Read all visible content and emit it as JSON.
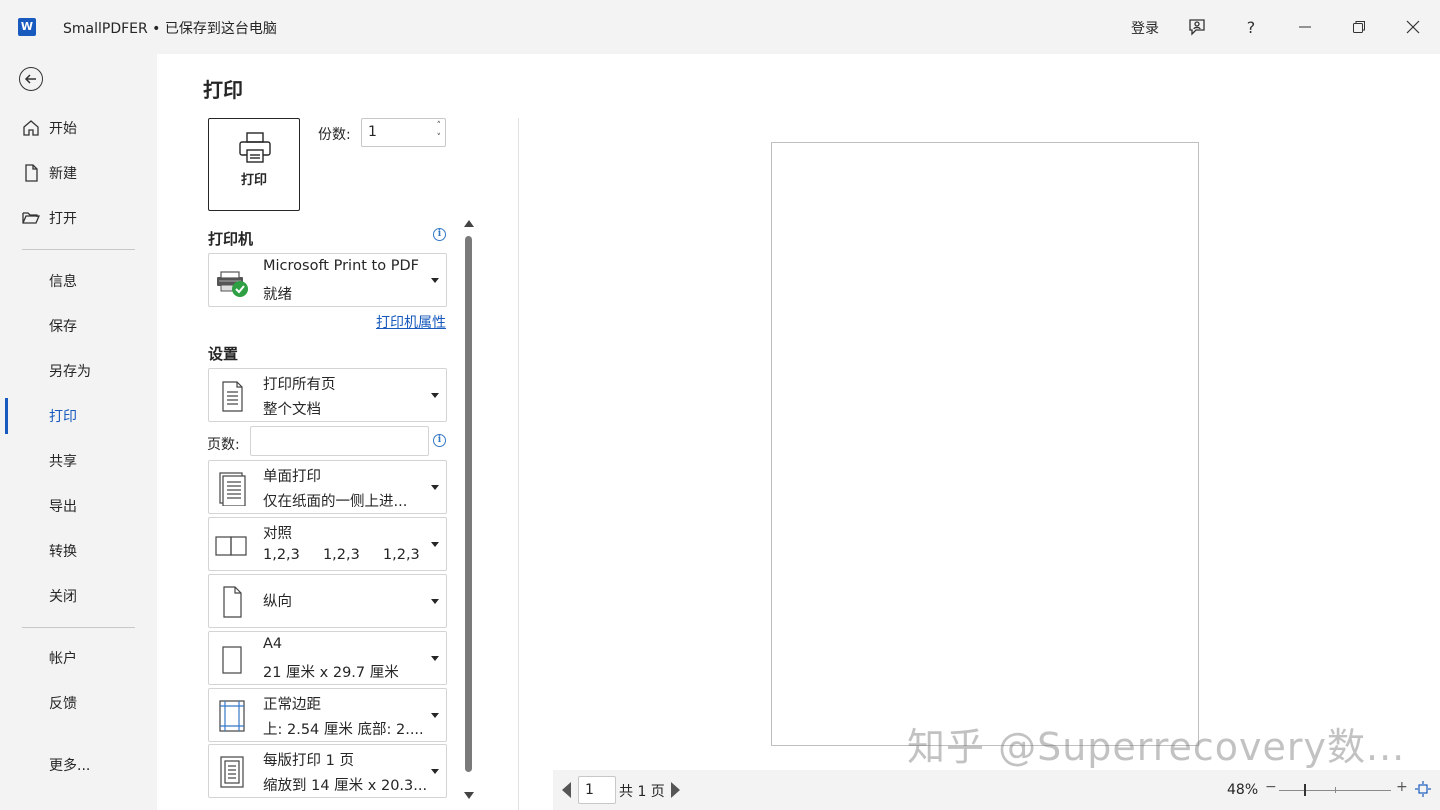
{
  "window": {
    "title": "SmallPDFER • 已保存到这台电脑",
    "app_letter": "W",
    "login": "登录",
    "help": "?"
  },
  "nav": {
    "top_items": [
      {
        "label": "开始"
      },
      {
        "label": "新建"
      },
      {
        "label": "打开"
      }
    ],
    "mid_items": [
      {
        "label": "信息"
      },
      {
        "label": "保存"
      },
      {
        "label": "另存为"
      },
      {
        "label": "打印",
        "active": true
      },
      {
        "label": "共享"
      },
      {
        "label": "导出"
      },
      {
        "label": "转换"
      },
      {
        "label": "关闭"
      }
    ],
    "bottom_items": [
      {
        "label": "帐户"
      },
      {
        "label": "反馈"
      },
      {
        "label": "更多..."
      }
    ]
  },
  "print": {
    "title": "打印",
    "print_button": "打印",
    "copies_label": "份数:",
    "copies_value": "1",
    "printer_section": "打印机",
    "printer_name": "Microsoft Print to PDF",
    "printer_status": "就绪",
    "printer_props": "打印机属性",
    "settings_section": "设置",
    "pages_label": "页数:",
    "pages_value": "",
    "settings": [
      {
        "l1": "打印所有页",
        "l2": "整个文档",
        "icon": "document-pages-icon"
      },
      {
        "l1": "单面打印",
        "l2": "仅在纸面的一侧上进...",
        "icon": "one-sided-icon"
      },
      {
        "l1": "对照",
        "l2": "1,2,3     1,2,3     1,2,3",
        "icon": "collate-icon"
      },
      {
        "l1": "纵向",
        "l2": "",
        "icon": "portrait-icon"
      },
      {
        "l1": "A4",
        "l2": "21 厘米 x 29.7 厘米",
        "icon": "paper-size-icon"
      },
      {
        "l1": "正常边距",
        "l2": "上: 2.54 厘米 底部: 2....",
        "icon": "margins-icon"
      },
      {
        "l1": "每版打印 1 页",
        "l2": "缩放到 14 厘米 x 20.3...",
        "icon": "pages-per-sheet-icon"
      }
    ]
  },
  "preview": {
    "page_current": "1",
    "page_total": "共 1 页",
    "zoom": "48%",
    "zoom_minus": "−",
    "zoom_plus": "+",
    "watermark": "知乎 @Superrecovery数..."
  },
  "colors": {
    "accent": "#185abd",
    "link": "#185abd",
    "ready_green": "#2ea043"
  }
}
